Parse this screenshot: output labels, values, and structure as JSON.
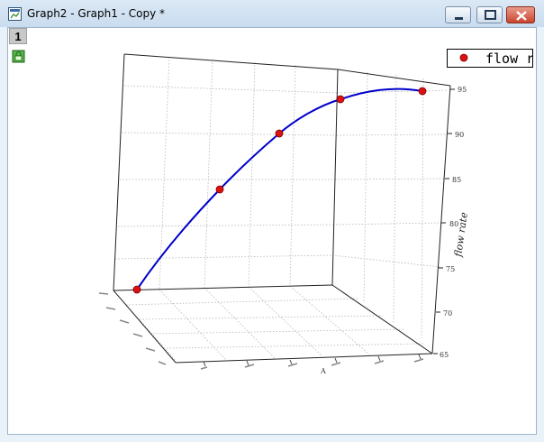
{
  "window": {
    "title": "Graph2 - Graph1 - Copy *",
    "layer_tab": "1",
    "icons": [
      "origin-graph-icon",
      "minimize-icon",
      "maximize-icon",
      "close-icon",
      "lock-icon"
    ]
  },
  "legend": {
    "label": "flow ra",
    "marker_color": "#dd1111"
  },
  "chart_data": {
    "type": "scatter",
    "title": "",
    "z_axis": {
      "label": "flow rate",
      "ticks": [
        65,
        70,
        75,
        80,
        85,
        90,
        95
      ],
      "range": [
        65,
        95
      ]
    },
    "x_axis": {
      "label": "A",
      "tick_labels": [
        "",
        "",
        "",
        "",
        "",
        ""
      ]
    },
    "y_axis": {
      "label": "",
      "tick_labels": [
        "",
        "",
        "",
        "",
        "",
        ""
      ]
    },
    "series": [
      {
        "name": "flow rate",
        "points": [
          {
            "z": 65
          },
          {
            "z": 84
          },
          {
            "z": 90
          },
          {
            "z": 94
          },
          {
            "z": 95
          }
        ],
        "fit_line_color": "#0000cc",
        "marker_color": "#dd1111"
      }
    ],
    "grid": true,
    "projection": "3d-box"
  }
}
